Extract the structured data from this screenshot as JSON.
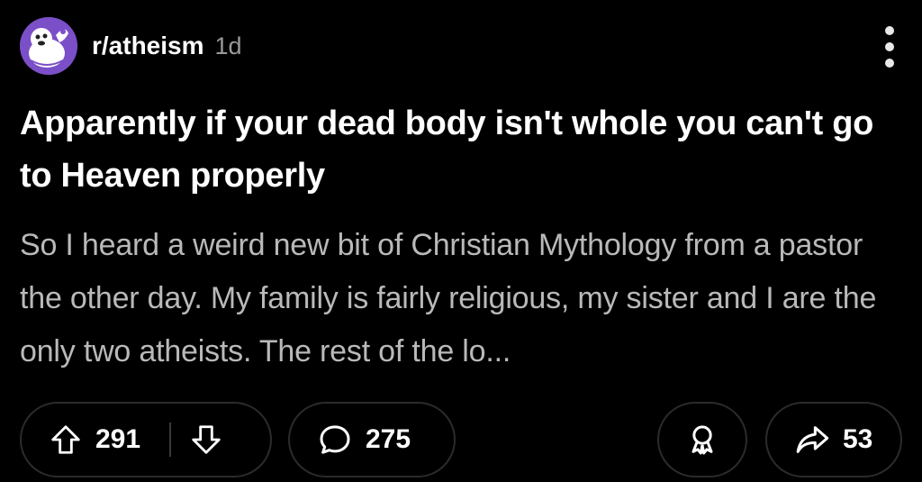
{
  "header": {
    "subreddit": "r/atheism",
    "age": "1d",
    "avatar_icon": "subreddit-mascot-icon",
    "more_icon": "more-vertical-icon"
  },
  "post": {
    "title": "Apparently if your dead body isn't whole you can't go to Heaven properly",
    "body": "So I heard a weird new bit of Christian Mythology from a pastor the other day. My family is fairly religious, my sister and I are the only two atheists. The rest of the lo..."
  },
  "actions": {
    "upvote_icon": "arrow-up-icon",
    "score": "291",
    "downvote_icon": "arrow-down-icon",
    "comment_icon": "comment-bubble-icon",
    "comments": "275",
    "award_icon": "award-icon",
    "share_icon": "share-arrow-icon",
    "shares": "53"
  },
  "colors": {
    "background": "#000000",
    "avatar_bg": "#7b4fc8",
    "body_text": "#b9b9b9",
    "meta_text": "#9a9a9a",
    "pill_border": "#2b2b2b"
  }
}
